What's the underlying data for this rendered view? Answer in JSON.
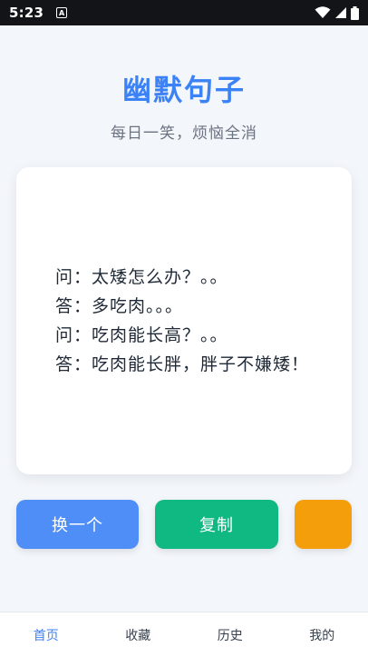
{
  "status_bar": {
    "time": "5:23",
    "app_icon_letter": "A",
    "icons": [
      "wifi-icon",
      "signal-icon",
      "battery-icon"
    ]
  },
  "header": {
    "title": "幽默句子",
    "subtitle": "每日一笑，烦恼全消"
  },
  "joke": {
    "lines": [
      "问：太矮怎么办？。。",
      "答：多吃肉。。。",
      "问：吃肉能长高？。。",
      "答：吃肉能长胖，胖子不嫌矮！"
    ]
  },
  "actions": {
    "change_label": "换一个",
    "copy_label": "复制",
    "extra_label": ""
  },
  "bottom_nav": {
    "active_index": 0,
    "items": [
      {
        "label": "首页"
      },
      {
        "label": "收藏"
      },
      {
        "label": "历史"
      },
      {
        "label": "我的"
      }
    ]
  },
  "colors": {
    "title": "#3b82f6",
    "change_button": "#4f8ef7",
    "copy_button": "#10b981",
    "extra_button": "#f59e0b",
    "nav_active": "#3b82f6"
  }
}
